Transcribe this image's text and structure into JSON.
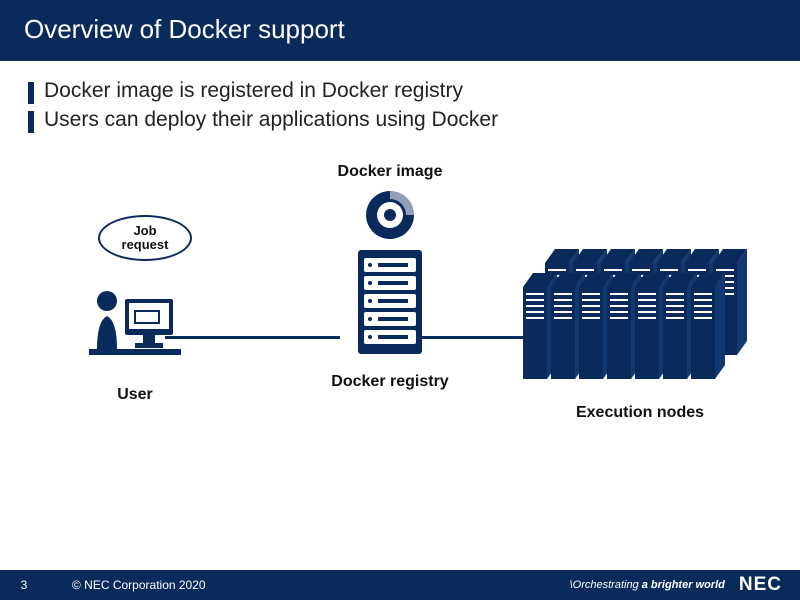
{
  "header": {
    "title": "Overview of Docker support"
  },
  "bullets": [
    "Docker image is registered in Docker registry",
    "Users can deploy their applications using Docker"
  ],
  "diagram": {
    "job_request": "Job\nrequest",
    "docker_image_label": "Docker image",
    "user_label": "User",
    "registry_label": "Docker registry",
    "exec_label": "Execution nodes"
  },
  "footer": {
    "page": "3",
    "copyright": "© NEC Corporation 2020",
    "tagline_prefix": "\\Orchestrating",
    "tagline_rest": " a brighter world",
    "logo": "NEC"
  }
}
